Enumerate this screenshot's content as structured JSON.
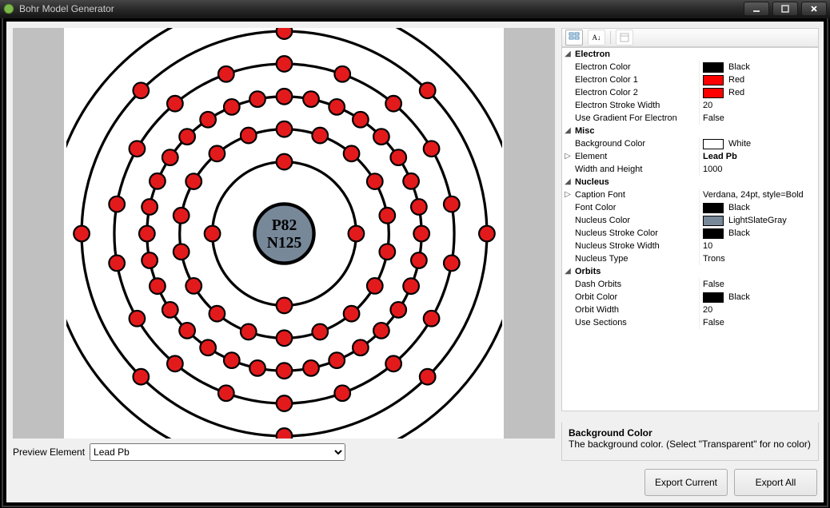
{
  "window": {
    "title": "Bohr Model Generator",
    "min_tooltip": "Minimize",
    "max_tooltip": "Maximize",
    "close_tooltip": "Close"
  },
  "preview": {
    "label": "Preview Element",
    "element_selected": "Lead Pb",
    "nucleus_p": "P82",
    "nucleus_n": "N125",
    "shells": [
      2,
      8,
      18,
      32,
      18,
      4
    ],
    "electron_fill": "#e31a1c",
    "orbit_color": "#000000",
    "nucleus_color": "#778899",
    "nucleus_stroke": "#000000",
    "background": "#ffffff"
  },
  "propgrid": {
    "toolbar": {
      "categorized": "categorized-view",
      "alphabetical": "alphabetical-view",
      "pages": "property-pages"
    },
    "groups": [
      {
        "name": "Electron",
        "expand": "expanded",
        "rows": [
          {
            "label": "Electron Color",
            "value": "Black",
            "swatch": "#000000"
          },
          {
            "label": "Electron Color 1",
            "value": "Red",
            "swatch": "#ff0000"
          },
          {
            "label": "Electron Color 2",
            "value": "Red",
            "swatch": "#ff0000"
          },
          {
            "label": "Electron Stroke Width",
            "value": "20"
          },
          {
            "label": "Use Gradient For Electron",
            "value": "False"
          }
        ]
      },
      {
        "name": "Misc",
        "expand": "expanded",
        "rows": [
          {
            "label": "Background Color",
            "value": "White",
            "swatch": "#ffffff"
          },
          {
            "label": "Element",
            "value": "Lead Pb",
            "bold": true,
            "expander": "collapsed"
          },
          {
            "label": "Width and Height",
            "value": "1000"
          }
        ]
      },
      {
        "name": "Nucleus",
        "expand": "expanded",
        "rows": [
          {
            "label": "Caption Font",
            "value": "Verdana, 24pt, style=Bold",
            "expander": "collapsed"
          },
          {
            "label": "Font Color",
            "value": "Black",
            "swatch": "#000000"
          },
          {
            "label": "Nucleus Color",
            "value": "LightSlateGray",
            "swatch": "#778899"
          },
          {
            "label": "Nucleus Stroke Color",
            "value": "Black",
            "swatch": "#000000"
          },
          {
            "label": "Nucleus Stroke Width",
            "value": "10"
          },
          {
            "label": "Nucleus Type",
            "value": "Trons"
          }
        ]
      },
      {
        "name": "Orbits",
        "expand": "expanded",
        "rows": [
          {
            "label": "Dash Orbits",
            "value": "False"
          },
          {
            "label": "Orbit Color",
            "value": "Black",
            "swatch": "#000000"
          },
          {
            "label": "Orbit Width",
            "value": "20"
          },
          {
            "label": "Use Sections",
            "value": "False"
          }
        ]
      }
    ]
  },
  "description": {
    "title": "Background Color",
    "text": "The background color. (Select \"Transparent\" for no color)"
  },
  "buttons": {
    "export_current": "Export Current",
    "export_all": "Export All"
  }
}
